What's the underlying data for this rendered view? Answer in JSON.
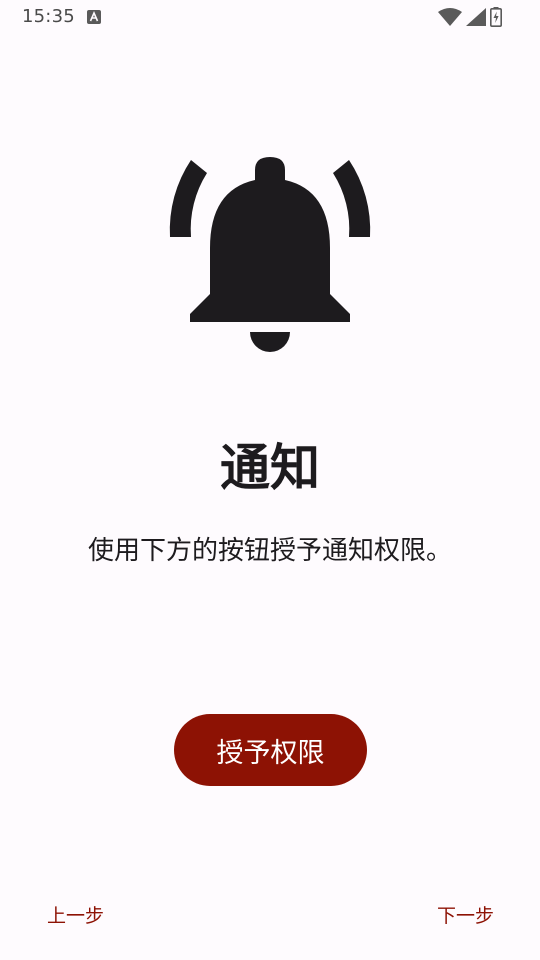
{
  "status_bar": {
    "time": "15:35",
    "icons": [
      "keyboard-a-icon",
      "wifi-icon",
      "signal-icon",
      "battery-charging-icon"
    ]
  },
  "main": {
    "icon": "notification-bell-icon",
    "title": "通知",
    "description": "使用下方的按钮授予通知权限。",
    "grant_button_label": "授予权限"
  },
  "navigation": {
    "prev_label": "上一步",
    "next_label": "下一步"
  },
  "colors": {
    "background": "#fefbfe",
    "accent": "#8d1204",
    "text": "#1d1b1e"
  }
}
